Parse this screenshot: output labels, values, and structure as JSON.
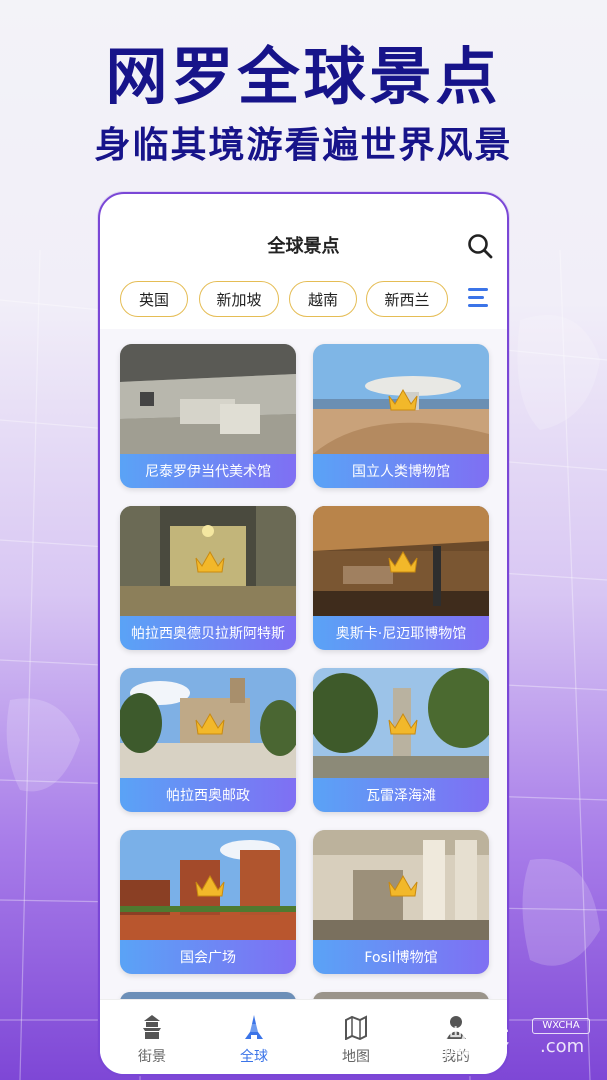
{
  "hero": {
    "title": "网罗全球景点",
    "subtitle": "身临其境游看遍世界风景"
  },
  "header": {
    "title": "全球景点",
    "search_icon": "search-icon"
  },
  "chips": [
    "英国",
    "新加坡",
    "越南",
    "新西兰"
  ],
  "menu_icon": "menu-icon",
  "cards": [
    {
      "label": "尼泰罗伊当代美术馆",
      "scene": "gallery-interior",
      "vip": false
    },
    {
      "label": "国立人类博物馆",
      "scene": "coast-museum",
      "vip": true
    },
    {
      "label": "帕拉西奥德贝拉斯阿特斯",
      "scene": "palace-hall",
      "vip": true
    },
    {
      "label": "奥斯卡·尼迈耶博物馆",
      "scene": "wood-room",
      "vip": true
    },
    {
      "label": "帕拉西奥邮政",
      "scene": "castle",
      "vip": true
    },
    {
      "label": "瓦雷泽海滩",
      "scene": "park-statue",
      "vip": true
    },
    {
      "label": "国会广场",
      "scene": "ruins",
      "vip": true
    },
    {
      "label": "Fosil博物馆",
      "scene": "museum-columns",
      "vip": true
    }
  ],
  "tabs": [
    {
      "label": "街景",
      "icon": "pagoda-icon",
      "active": false
    },
    {
      "label": "全球",
      "icon": "tower-icon",
      "active": true
    },
    {
      "label": "地图",
      "icon": "map-icon",
      "active": false
    },
    {
      "label": "我的",
      "icon": "user-icon",
      "active": false
    }
  ],
  "watermark": {
    "text": "微茶",
    "badge": "WXCHA",
    "domain": ".com"
  },
  "colors": {
    "title": "#17148a",
    "accent": "#3b74e8",
    "chip_border": "#e5bd55",
    "frame": "#7a47d6"
  }
}
